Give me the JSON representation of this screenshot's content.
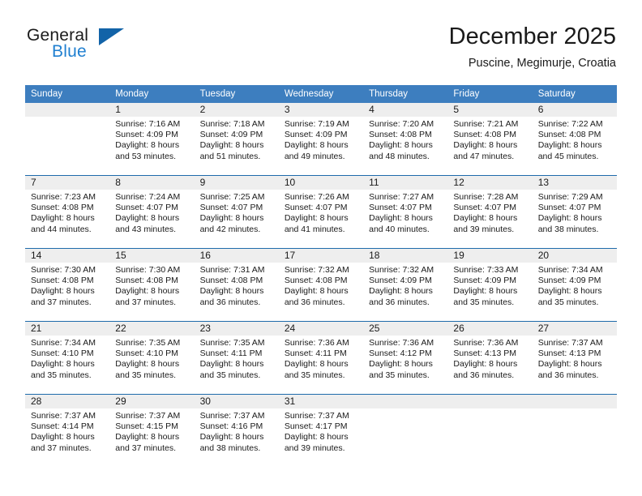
{
  "brand": {
    "name_part1": "General",
    "name_part2": "Blue",
    "logo_icon": "triangle-logo-icon"
  },
  "header": {
    "title": "December 2025",
    "subtitle": "Puscine, Megimurje, Croatia"
  },
  "colors": {
    "header_bar": "#3d7ebf",
    "row_separator": "#1f6bab",
    "daynum_band": "#eeeeee",
    "brand_blue": "#1f7fd0",
    "logo_blue": "#1263a8",
    "text": "#1a1a1a"
  },
  "weekday_headers": [
    "Sunday",
    "Monday",
    "Tuesday",
    "Wednesday",
    "Thursday",
    "Friday",
    "Saturday"
  ],
  "weeks": [
    {
      "days": [
        {
          "date": "",
          "empty": true,
          "sunrise": "",
          "sunset": "",
          "daylight_line1": "",
          "daylight_line2": ""
        },
        {
          "date": "1",
          "empty": false,
          "sunrise": "Sunrise: 7:16 AM",
          "sunset": "Sunset: 4:09 PM",
          "daylight_line1": "Daylight: 8 hours",
          "daylight_line2": "and 53 minutes."
        },
        {
          "date": "2",
          "empty": false,
          "sunrise": "Sunrise: 7:18 AM",
          "sunset": "Sunset: 4:09 PM",
          "daylight_line1": "Daylight: 8 hours",
          "daylight_line2": "and 51 minutes."
        },
        {
          "date": "3",
          "empty": false,
          "sunrise": "Sunrise: 7:19 AM",
          "sunset": "Sunset: 4:09 PM",
          "daylight_line1": "Daylight: 8 hours",
          "daylight_line2": "and 49 minutes."
        },
        {
          "date": "4",
          "empty": false,
          "sunrise": "Sunrise: 7:20 AM",
          "sunset": "Sunset: 4:08 PM",
          "daylight_line1": "Daylight: 8 hours",
          "daylight_line2": "and 48 minutes."
        },
        {
          "date": "5",
          "empty": false,
          "sunrise": "Sunrise: 7:21 AM",
          "sunset": "Sunset: 4:08 PM",
          "daylight_line1": "Daylight: 8 hours",
          "daylight_line2": "and 47 minutes."
        },
        {
          "date": "6",
          "empty": false,
          "sunrise": "Sunrise: 7:22 AM",
          "sunset": "Sunset: 4:08 PM",
          "daylight_line1": "Daylight: 8 hours",
          "daylight_line2": "and 45 minutes."
        }
      ]
    },
    {
      "days": [
        {
          "date": "7",
          "empty": false,
          "sunrise": "Sunrise: 7:23 AM",
          "sunset": "Sunset: 4:08 PM",
          "daylight_line1": "Daylight: 8 hours",
          "daylight_line2": "and 44 minutes."
        },
        {
          "date": "8",
          "empty": false,
          "sunrise": "Sunrise: 7:24 AM",
          "sunset": "Sunset: 4:07 PM",
          "daylight_line1": "Daylight: 8 hours",
          "daylight_line2": "and 43 minutes."
        },
        {
          "date": "9",
          "empty": false,
          "sunrise": "Sunrise: 7:25 AM",
          "sunset": "Sunset: 4:07 PM",
          "daylight_line1": "Daylight: 8 hours",
          "daylight_line2": "and 42 minutes."
        },
        {
          "date": "10",
          "empty": false,
          "sunrise": "Sunrise: 7:26 AM",
          "sunset": "Sunset: 4:07 PM",
          "daylight_line1": "Daylight: 8 hours",
          "daylight_line2": "and 41 minutes."
        },
        {
          "date": "11",
          "empty": false,
          "sunrise": "Sunrise: 7:27 AM",
          "sunset": "Sunset: 4:07 PM",
          "daylight_line1": "Daylight: 8 hours",
          "daylight_line2": "and 40 minutes."
        },
        {
          "date": "12",
          "empty": false,
          "sunrise": "Sunrise: 7:28 AM",
          "sunset": "Sunset: 4:07 PM",
          "daylight_line1": "Daylight: 8 hours",
          "daylight_line2": "and 39 minutes."
        },
        {
          "date": "13",
          "empty": false,
          "sunrise": "Sunrise: 7:29 AM",
          "sunset": "Sunset: 4:07 PM",
          "daylight_line1": "Daylight: 8 hours",
          "daylight_line2": "and 38 minutes."
        }
      ]
    },
    {
      "days": [
        {
          "date": "14",
          "empty": false,
          "sunrise": "Sunrise: 7:30 AM",
          "sunset": "Sunset: 4:08 PM",
          "daylight_line1": "Daylight: 8 hours",
          "daylight_line2": "and 37 minutes."
        },
        {
          "date": "15",
          "empty": false,
          "sunrise": "Sunrise: 7:30 AM",
          "sunset": "Sunset: 4:08 PM",
          "daylight_line1": "Daylight: 8 hours",
          "daylight_line2": "and 37 minutes."
        },
        {
          "date": "16",
          "empty": false,
          "sunrise": "Sunrise: 7:31 AM",
          "sunset": "Sunset: 4:08 PM",
          "daylight_line1": "Daylight: 8 hours",
          "daylight_line2": "and 36 minutes."
        },
        {
          "date": "17",
          "empty": false,
          "sunrise": "Sunrise: 7:32 AM",
          "sunset": "Sunset: 4:08 PM",
          "daylight_line1": "Daylight: 8 hours",
          "daylight_line2": "and 36 minutes."
        },
        {
          "date": "18",
          "empty": false,
          "sunrise": "Sunrise: 7:32 AM",
          "sunset": "Sunset: 4:09 PM",
          "daylight_line1": "Daylight: 8 hours",
          "daylight_line2": "and 36 minutes."
        },
        {
          "date": "19",
          "empty": false,
          "sunrise": "Sunrise: 7:33 AM",
          "sunset": "Sunset: 4:09 PM",
          "daylight_line1": "Daylight: 8 hours",
          "daylight_line2": "and 35 minutes."
        },
        {
          "date": "20",
          "empty": false,
          "sunrise": "Sunrise: 7:34 AM",
          "sunset": "Sunset: 4:09 PM",
          "daylight_line1": "Daylight: 8 hours",
          "daylight_line2": "and 35 minutes."
        }
      ]
    },
    {
      "days": [
        {
          "date": "21",
          "empty": false,
          "sunrise": "Sunrise: 7:34 AM",
          "sunset": "Sunset: 4:10 PM",
          "daylight_line1": "Daylight: 8 hours",
          "daylight_line2": "and 35 minutes."
        },
        {
          "date": "22",
          "empty": false,
          "sunrise": "Sunrise: 7:35 AM",
          "sunset": "Sunset: 4:10 PM",
          "daylight_line1": "Daylight: 8 hours",
          "daylight_line2": "and 35 minutes."
        },
        {
          "date": "23",
          "empty": false,
          "sunrise": "Sunrise: 7:35 AM",
          "sunset": "Sunset: 4:11 PM",
          "daylight_line1": "Daylight: 8 hours",
          "daylight_line2": "and 35 minutes."
        },
        {
          "date": "24",
          "empty": false,
          "sunrise": "Sunrise: 7:36 AM",
          "sunset": "Sunset: 4:11 PM",
          "daylight_line1": "Daylight: 8 hours",
          "daylight_line2": "and 35 minutes."
        },
        {
          "date": "25",
          "empty": false,
          "sunrise": "Sunrise: 7:36 AM",
          "sunset": "Sunset: 4:12 PM",
          "daylight_line1": "Daylight: 8 hours",
          "daylight_line2": "and 35 minutes."
        },
        {
          "date": "26",
          "empty": false,
          "sunrise": "Sunrise: 7:36 AM",
          "sunset": "Sunset: 4:13 PM",
          "daylight_line1": "Daylight: 8 hours",
          "daylight_line2": "and 36 minutes."
        },
        {
          "date": "27",
          "empty": false,
          "sunrise": "Sunrise: 7:37 AM",
          "sunset": "Sunset: 4:13 PM",
          "daylight_line1": "Daylight: 8 hours",
          "daylight_line2": "and 36 minutes."
        }
      ]
    },
    {
      "days": [
        {
          "date": "28",
          "empty": false,
          "sunrise": "Sunrise: 7:37 AM",
          "sunset": "Sunset: 4:14 PM",
          "daylight_line1": "Daylight: 8 hours",
          "daylight_line2": "and 37 minutes."
        },
        {
          "date": "29",
          "empty": false,
          "sunrise": "Sunrise: 7:37 AM",
          "sunset": "Sunset: 4:15 PM",
          "daylight_line1": "Daylight: 8 hours",
          "daylight_line2": "and 37 minutes."
        },
        {
          "date": "30",
          "empty": false,
          "sunrise": "Sunrise: 7:37 AM",
          "sunset": "Sunset: 4:16 PM",
          "daylight_line1": "Daylight: 8 hours",
          "daylight_line2": "and 38 minutes."
        },
        {
          "date": "31",
          "empty": false,
          "sunrise": "Sunrise: 7:37 AM",
          "sunset": "Sunset: 4:17 PM",
          "daylight_line1": "Daylight: 8 hours",
          "daylight_line2": "and 39 minutes."
        },
        {
          "date": "",
          "empty": true,
          "sunrise": "",
          "sunset": "",
          "daylight_line1": "",
          "daylight_line2": ""
        },
        {
          "date": "",
          "empty": true,
          "sunrise": "",
          "sunset": "",
          "daylight_line1": "",
          "daylight_line2": ""
        },
        {
          "date": "",
          "empty": true,
          "sunrise": "",
          "sunset": "",
          "daylight_line1": "",
          "daylight_line2": ""
        }
      ]
    }
  ]
}
